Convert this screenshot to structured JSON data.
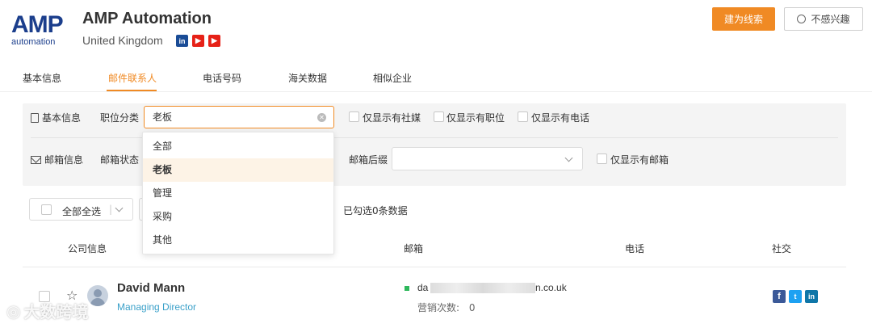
{
  "company": {
    "logo_main": "AMP",
    "logo_sub": "automation",
    "name": "AMP Automation",
    "country": "United Kingdom",
    "social_icons": [
      "linkedin-icon",
      "youtube-icon",
      "youtube-icon"
    ]
  },
  "actions": {
    "primary_label": "建为线索",
    "secondary_label": "不感兴趣"
  },
  "tabs": [
    {
      "label": "基本信息",
      "active": false
    },
    {
      "label": "邮件联系人",
      "active": true
    },
    {
      "label": "电话号码",
      "active": false
    },
    {
      "label": "海关数据",
      "active": false
    },
    {
      "label": "相似企业",
      "active": false
    }
  ],
  "filters": {
    "basic_section": "基本信息",
    "position_label": "职位分类",
    "position_value": "老板",
    "checkboxes_row1": [
      "仅显示有社媒",
      "仅显示有职位",
      "仅显示有电话"
    ],
    "mail_section": "邮箱信息",
    "mail_status_label": "邮箱状态",
    "mail_suffix_label": "邮箱后缀",
    "checkbox_row2": "仅显示有邮箱"
  },
  "dropdown": {
    "options": [
      "全部",
      "老板",
      "管理",
      "采购",
      "其他"
    ],
    "selected_index": 1
  },
  "selection": {
    "select_all_label": "全部全选",
    "selected_count_text": "已勾选0条数据"
  },
  "table": {
    "headers": [
      "公司信息",
      "邮箱",
      "电话",
      "社交"
    ],
    "rows": [
      {
        "name": "David Mann",
        "title": "Managing Director",
        "email_prefix": "da",
        "email_suffix": "n.co.uk",
        "marketing_label": "营销次数:",
        "marketing_count": "0",
        "social": [
          "facebook-icon",
          "twitter-icon",
          "linkedin-icon"
        ]
      }
    ]
  },
  "watermark": "大数跨境",
  "colors": {
    "accent": "#f08a24",
    "brand_blue": "#1b3e8c",
    "link": "#3aa0c9",
    "email_valid": "#2eb85c"
  }
}
